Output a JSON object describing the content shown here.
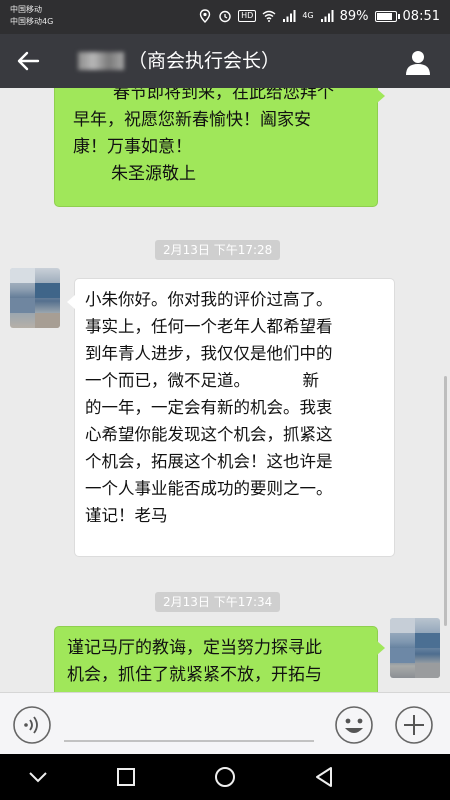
{
  "status_bar": {
    "carrier_line1": "中国移动",
    "carrier_line2": "中国移动4G",
    "hd_badge": "HD",
    "network_type": "4G",
    "battery_percent": "89%",
    "battery_level": 0.89,
    "time": "08:51"
  },
  "header": {
    "title": "（商会执行会长）",
    "back_icon": "arrow-left-icon",
    "contact_icon": "person-icon"
  },
  "messages": [
    {
      "sender": "me",
      "lines": [
        "春节即将到来，在此给您拜个",
        "早年，祝愿您新春愉快！阖家安",
        "康！万事如意！",
        "朱圣源敬上"
      ]
    },
    {
      "type": "timestamp",
      "text": "2月13日 下午17:28"
    },
    {
      "sender": "other",
      "lines": [
        "小朱你好。你对我的评价过高了。",
        "事实上，任何一个老年人都希望看",
        "到年青人进步，我仅仅是他们中的",
        "一个而已，微不足道。          新",
        "的一年，一定会有新的机会。我衷",
        "心希望你能发现这个机会，抓紧这",
        "个机会，拓展这个机会！这也许是",
        "一个人事业能否成功的要则之一。",
        "谨记！老马"
      ]
    },
    {
      "type": "timestamp",
      "text": "2月13日 下午17:34"
    },
    {
      "sender": "me",
      "lines": [
        "谨记马厅的教诲，定当努力探寻此",
        "机会，抓住了就紧紧不放，开拓与"
      ]
    }
  ],
  "input_bar": {
    "voice_icon": "voice-icon",
    "emoji_icon": "emoji-icon",
    "plus_icon": "plus-icon"
  },
  "nav_bar": {
    "back_icon": "nav-back-icon",
    "home_icon": "nav-home-icon",
    "recents_icon": "nav-recents-icon"
  },
  "colors": {
    "my_bubble": "#a0e75a",
    "other_bubble": "#ffffff",
    "chat_background": "#ebebeb",
    "title_bar": "#393a3f"
  }
}
